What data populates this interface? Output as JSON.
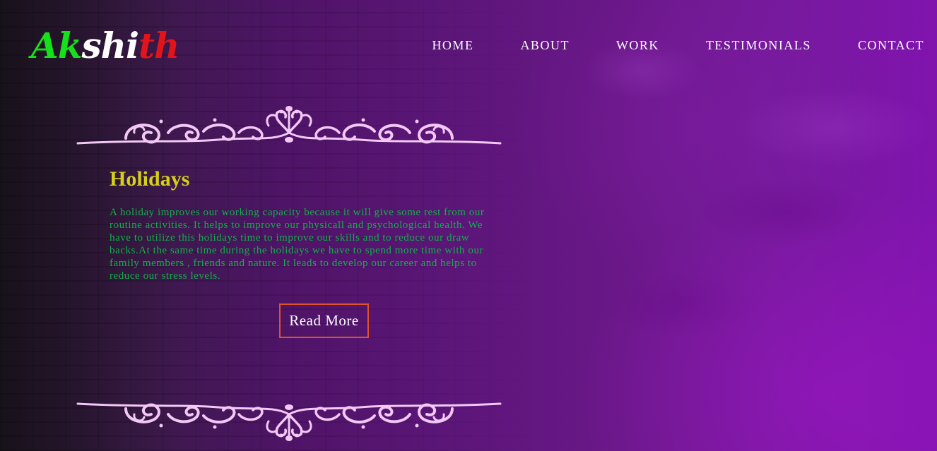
{
  "logo": {
    "part1": "Ak",
    "part2": "shi",
    "part3": "th"
  },
  "nav": {
    "items": [
      {
        "label": "HOME"
      },
      {
        "label": "ABOUT"
      },
      {
        "label": "WORK"
      },
      {
        "label": "TESTIMONIALS"
      },
      {
        "label": "CONTACT"
      }
    ]
  },
  "article": {
    "title": "Holidays",
    "body": "A holiday improves our working capacity because it will give some rest from our routine activities. It helps to improve our physicall and psychological health. We have to utilize this holidays time to improve our skills and to reduce our draw backs.At the same time during the holidays we have to spend more time with our family members , friends and nature. It leads to develop our career and helps to reduce our stress levels.",
    "read_more_label": "Read More"
  },
  "colors": {
    "logo_green": "#16e01c",
    "logo_white": "#ffffff",
    "logo_red": "#e0141a",
    "heading_yellow": "#d4cf1a",
    "body_green": "#12b04a",
    "button_border": "#e0532a",
    "ornament_pink": "#f2c8f4",
    "background_purple": "#6a1888"
  },
  "icons": {
    "ornament_top": "scroll-flourish-divider-icon",
    "ornament_bottom": "scroll-flourish-divider-icon"
  }
}
